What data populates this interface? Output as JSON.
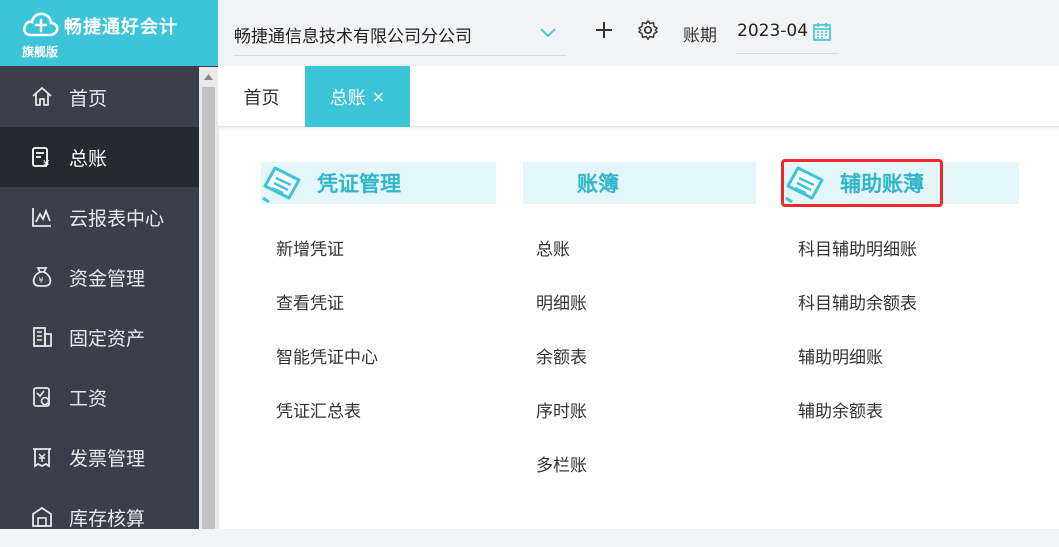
{
  "brand": {
    "title": "畅捷通好会计",
    "edition": "旗舰版",
    "color": "#3cc4d8"
  },
  "sidebar": {
    "items": [
      {
        "label": "首页",
        "icon": "home-icon"
      },
      {
        "label": "总账",
        "icon": "ledger-icon",
        "active": true
      },
      {
        "label": "云报表中心",
        "icon": "chart-icon"
      },
      {
        "label": "资金管理",
        "icon": "money-bag-icon"
      },
      {
        "label": "固定资产",
        "icon": "building-icon"
      },
      {
        "label": "工资",
        "icon": "salary-icon"
      },
      {
        "label": "发票管理",
        "icon": "invoice-icon"
      },
      {
        "label": "库存核算",
        "icon": "warehouse-icon"
      }
    ]
  },
  "header": {
    "company": "畅捷通信息技术有限公司分公司",
    "period_label": "账期",
    "period_value": "2023-04"
  },
  "tabs": [
    {
      "label": "首页"
    },
    {
      "label": "总账",
      "active": true,
      "close": "×"
    }
  ],
  "menu": {
    "voucher": {
      "title": "凭证管理",
      "items": [
        "新增凭证",
        "查看凭证",
        "智能凭证中心",
        "凭证汇总表"
      ]
    },
    "books": {
      "title": "账簿",
      "items": [
        "总账",
        "明细账",
        "余额表",
        "序时账",
        "多栏账"
      ]
    },
    "aux": {
      "title": "辅助账薄",
      "items": [
        "科目辅助明细账",
        "科目辅助余额表",
        "辅助明细账",
        "辅助余额表"
      ]
    }
  }
}
